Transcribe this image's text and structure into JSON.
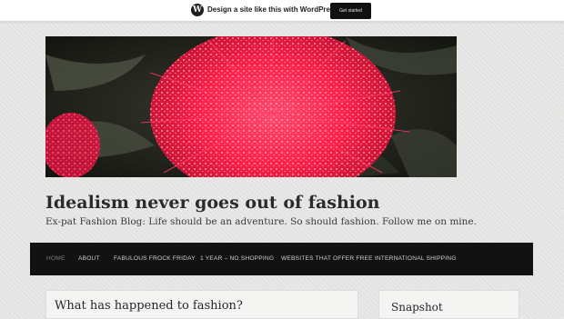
{
  "promo_bar": {
    "logo_letter": "W",
    "message": "Design a site like this with WordPress.com",
    "cta_label": "Get started"
  },
  "site": {
    "title": "Idealism never goes out of fashion",
    "tagline": "Ex-pat Fashion Blog: Life should be an adventure. So should fashion. Follow me on mine."
  },
  "nav": {
    "items": [
      {
        "label": "Home",
        "current": true
      },
      {
        "label": "About"
      },
      {
        "label": "Fabulous Frock Friday"
      },
      {
        "label": "1 year – no shopping"
      },
      {
        "label": "Websites that offer free international shipping"
      }
    ]
  },
  "main": {
    "post_title": "What has happened to fashion?"
  },
  "sidebar": {
    "widget_title": "Snapshot"
  },
  "colors": {
    "background": "#e6e6e4",
    "nav_background": "#121212",
    "flower": "#ff1f4e"
  },
  "header_image": {
    "icon": "red-bottlebrush-flower-photo"
  }
}
